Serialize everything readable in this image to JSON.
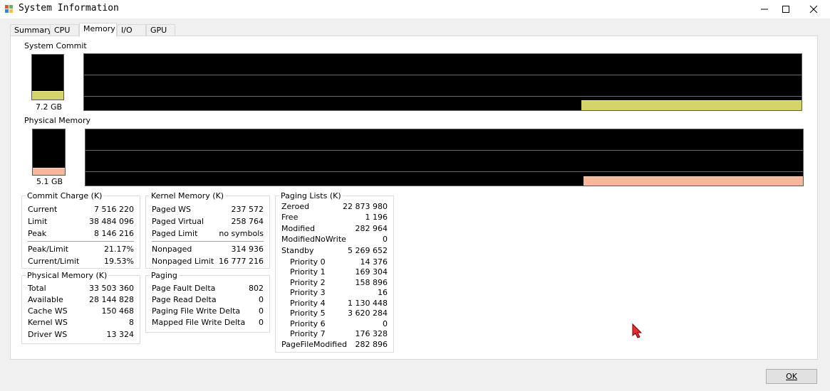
{
  "window": {
    "title": "System Information"
  },
  "tabs": [
    "Summary",
    "CPU",
    "Memory",
    "I/O",
    "GPU"
  ],
  "active_tab": "Memory",
  "colors": {
    "commit_fill": "#d4d46a",
    "physical_fill": "#f5b89a",
    "graph_bg": "#000000"
  },
  "system_commit": {
    "label": "System Commit",
    "value": "7.2 GB",
    "level": 0.19
  },
  "physical_memory": {
    "label": "Physical Memory",
    "value": "5.1 GB",
    "level": 0.15
  },
  "commit_charge": {
    "title": "Commit Charge (K)",
    "rows": [
      {
        "k": "Current",
        "v": "7 516 220"
      },
      {
        "k": "Limit",
        "v": "38 484 096"
      },
      {
        "k": "Peak",
        "v": "8 146 216"
      }
    ],
    "rows2": [
      {
        "k": "Peak/Limit",
        "v": "21.17%"
      },
      {
        "k": "Current/Limit",
        "v": "19.53%"
      }
    ]
  },
  "physical_memory_k": {
    "title": "Physical Memory (K)",
    "rows": [
      {
        "k": "Total",
        "v": "33 503 360"
      },
      {
        "k": "Available",
        "v": "28 144 828"
      },
      {
        "k": "Cache WS",
        "v": "150 468"
      },
      {
        "k": "Kernel WS",
        "v": "8"
      },
      {
        "k": "Driver WS",
        "v": "13 324"
      }
    ]
  },
  "kernel_memory": {
    "title": "Kernel Memory (K)",
    "rows": [
      {
        "k": "Paged WS",
        "v": "237 572"
      },
      {
        "k": "Paged Virtual",
        "v": "258 764"
      },
      {
        "k": "Paged Limit",
        "v": "no symbols"
      }
    ],
    "rows2": [
      {
        "k": "Nonpaged",
        "v": "314 936"
      },
      {
        "k": "Nonpaged Limit",
        "v": "16 777 216"
      }
    ]
  },
  "paging": {
    "title": "Paging",
    "rows": [
      {
        "k": "Page Fault Delta",
        "v": "802"
      },
      {
        "k": "Page Read Delta",
        "v": "0"
      },
      {
        "k": "Paging File Write Delta",
        "v": "0"
      },
      {
        "k": "Mapped File Write Delta",
        "v": "0"
      }
    ]
  },
  "paging_lists": {
    "title": "Paging Lists (K)",
    "rows": [
      {
        "k": "Zeroed",
        "v": "22 873 980"
      },
      {
        "k": "Free",
        "v": "1 196"
      },
      {
        "k": "Modified",
        "v": "282 964"
      },
      {
        "k": "ModifiedNoWrite",
        "v": "0"
      },
      {
        "k": "Standby",
        "v": "5 269 652"
      },
      {
        "k": "Priority 0",
        "v": "14 376"
      },
      {
        "k": "Priority 1",
        "v": "169 304"
      },
      {
        "k": "Priority 2",
        "v": "158 896"
      },
      {
        "k": "Priority 3",
        "v": "16"
      },
      {
        "k": "Priority 4",
        "v": "1 130 448"
      },
      {
        "k": "Priority 5",
        "v": "3 620 284"
      },
      {
        "k": "Priority 6",
        "v": "0"
      },
      {
        "k": "Priority 7",
        "v": "176 328"
      },
      {
        "k": "PageFileModified",
        "v": "282 896"
      }
    ]
  },
  "ok_label": "OK"
}
